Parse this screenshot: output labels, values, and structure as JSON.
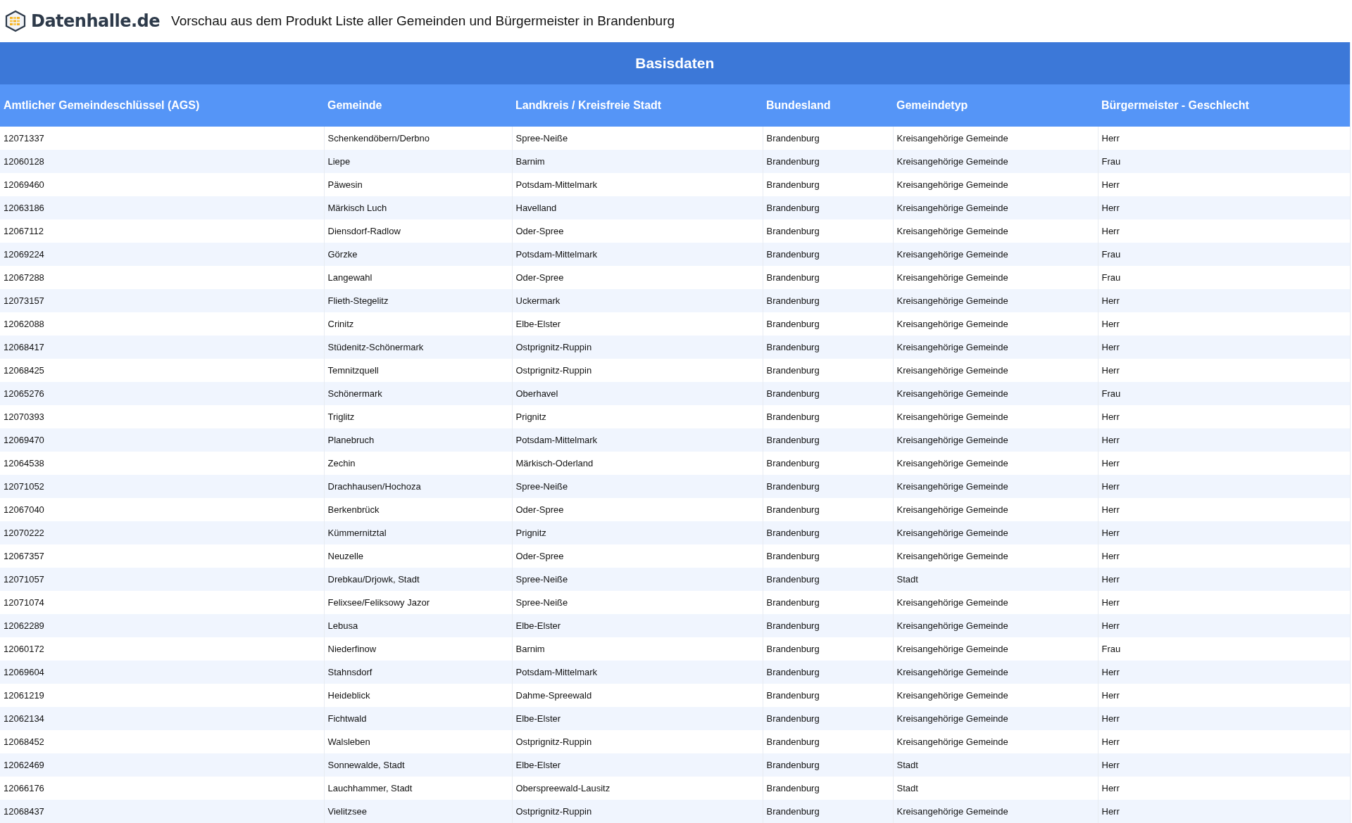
{
  "header": {
    "logo_text": "Datenhalle.de",
    "title": "Vorschau aus dem Produkt Liste aller Gemeinden und Bürgermeister in Brandenburg"
  },
  "table": {
    "group_title": "Basisdaten",
    "columns": [
      "Amtlicher Gemeindeschlüssel (AGS)",
      "Gemeinde",
      "Landkreis / Kreisfreie Stadt",
      "Bundesland",
      "Gemeindetyp",
      "Bürgermeister - Geschlecht"
    ],
    "rows": [
      [
        "12071337",
        "Schenkendöbern/Derbno",
        "Spree-Neiße",
        "Brandenburg",
        "Kreisangehörige Gemeinde",
        "Herr"
      ],
      [
        "12060128",
        "Liepe",
        "Barnim",
        "Brandenburg",
        "Kreisangehörige Gemeinde",
        "Frau"
      ],
      [
        "12069460",
        "Päwesin",
        "Potsdam-Mittelmark",
        "Brandenburg",
        "Kreisangehörige Gemeinde",
        "Herr"
      ],
      [
        "12063186",
        "Märkisch Luch",
        "Havelland",
        "Brandenburg",
        "Kreisangehörige Gemeinde",
        "Herr"
      ],
      [
        "12067112",
        "Diensdorf-Radlow",
        "Oder-Spree",
        "Brandenburg",
        "Kreisangehörige Gemeinde",
        "Herr"
      ],
      [
        "12069224",
        "Görzke",
        "Potsdam-Mittelmark",
        "Brandenburg",
        "Kreisangehörige Gemeinde",
        "Frau"
      ],
      [
        "12067288",
        "Langewahl",
        "Oder-Spree",
        "Brandenburg",
        "Kreisangehörige Gemeinde",
        "Frau"
      ],
      [
        "12073157",
        "Flieth-Stegelitz",
        "Uckermark",
        "Brandenburg",
        "Kreisangehörige Gemeinde",
        "Herr"
      ],
      [
        "12062088",
        "Crinitz",
        "Elbe-Elster",
        "Brandenburg",
        "Kreisangehörige Gemeinde",
        "Herr"
      ],
      [
        "12068417",
        "Stüdenitz-Schönermark",
        "Ostprignitz-Ruppin",
        "Brandenburg",
        "Kreisangehörige Gemeinde",
        "Herr"
      ],
      [
        "12068425",
        "Temnitzquell",
        "Ostprignitz-Ruppin",
        "Brandenburg",
        "Kreisangehörige Gemeinde",
        "Herr"
      ],
      [
        "12065276",
        "Schönermark",
        "Oberhavel",
        "Brandenburg",
        "Kreisangehörige Gemeinde",
        "Frau"
      ],
      [
        "12070393",
        "Triglitz",
        "Prignitz",
        "Brandenburg",
        "Kreisangehörige Gemeinde",
        "Herr"
      ],
      [
        "12069470",
        "Planebruch",
        "Potsdam-Mittelmark",
        "Brandenburg",
        "Kreisangehörige Gemeinde",
        "Herr"
      ],
      [
        "12064538",
        "Zechin",
        "Märkisch-Oderland",
        "Brandenburg",
        "Kreisangehörige Gemeinde",
        "Herr"
      ],
      [
        "12071052",
        "Drachhausen/Hochoza",
        "Spree-Neiße",
        "Brandenburg",
        "Kreisangehörige Gemeinde",
        "Herr"
      ],
      [
        "12067040",
        "Berkenbrück",
        "Oder-Spree",
        "Brandenburg",
        "Kreisangehörige Gemeinde",
        "Herr"
      ],
      [
        "12070222",
        "Kümmernitztal",
        "Prignitz",
        "Brandenburg",
        "Kreisangehörige Gemeinde",
        "Herr"
      ],
      [
        "12067357",
        "Neuzelle",
        "Oder-Spree",
        "Brandenburg",
        "Kreisangehörige Gemeinde",
        "Herr"
      ],
      [
        "12071057",
        "Drebkau/Drjowk, Stadt",
        "Spree-Neiße",
        "Brandenburg",
        "Stadt",
        "Herr"
      ],
      [
        "12071074",
        "Felixsee/Feliksowy Jazor",
        "Spree-Neiße",
        "Brandenburg",
        "Kreisangehörige Gemeinde",
        "Herr"
      ],
      [
        "12062289",
        "Lebusa",
        "Elbe-Elster",
        "Brandenburg",
        "Kreisangehörige Gemeinde",
        "Herr"
      ],
      [
        "12060172",
        "Niederfinow",
        "Barnim",
        "Brandenburg",
        "Kreisangehörige Gemeinde",
        "Frau"
      ],
      [
        "12069604",
        "Stahnsdorf",
        "Potsdam-Mittelmark",
        "Brandenburg",
        "Kreisangehörige Gemeinde",
        "Herr"
      ],
      [
        "12061219",
        "Heideblick",
        "Dahme-Spreewald",
        "Brandenburg",
        "Kreisangehörige Gemeinde",
        "Herr"
      ],
      [
        "12062134",
        "Fichtwald",
        "Elbe-Elster",
        "Brandenburg",
        "Kreisangehörige Gemeinde",
        "Herr"
      ],
      [
        "12068452",
        "Walsleben",
        "Ostprignitz-Ruppin",
        "Brandenburg",
        "Kreisangehörige Gemeinde",
        "Herr"
      ],
      [
        "12062469",
        "Sonnewalde, Stadt",
        "Elbe-Elster",
        "Brandenburg",
        "Stadt",
        "Herr"
      ],
      [
        "12066176",
        "Lauchhammer, Stadt",
        "Oberspreewald-Lausitz",
        "Brandenburg",
        "Stadt",
        "Herr"
      ],
      [
        "12068437",
        "Vielitzsee",
        "Ostprignitz-Ruppin",
        "Brandenburg",
        "Kreisangehörige Gemeinde",
        "Herr"
      ]
    ]
  }
}
